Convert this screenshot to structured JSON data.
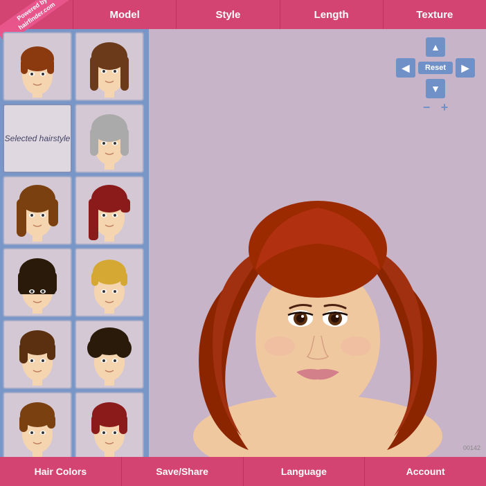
{
  "app": {
    "logo_line1": "Powered by",
    "logo_line2": "hairfinder.com"
  },
  "top_nav": {
    "tabs": [
      {
        "id": "model",
        "label": "Model"
      },
      {
        "id": "style",
        "label": "Style"
      },
      {
        "id": "length",
        "label": "Length"
      },
      {
        "id": "texture",
        "label": "Texture"
      }
    ]
  },
  "sidebar": {
    "selected_label": "Selected hairstyle",
    "thumbnails": [
      {
        "id": 1,
        "alt": "short auburn style"
      },
      {
        "id": 2,
        "alt": "medium layered style"
      },
      {
        "id": 3,
        "alt": "bob style"
      },
      {
        "id": 4,
        "alt": "red asymmetric style"
      },
      {
        "id": 5,
        "alt": "wavy brown style"
      },
      {
        "id": 6,
        "alt": "straight bob style"
      },
      {
        "id": 7,
        "alt": "short blonde style"
      },
      {
        "id": 8,
        "alt": "short wavy style"
      },
      {
        "id": 9,
        "alt": "curly short style"
      },
      {
        "id": 10,
        "alt": "style 10"
      },
      {
        "id": 11,
        "alt": "style 11"
      }
    ]
  },
  "controls": {
    "reset_label": "Reset",
    "up_arrow": "▲",
    "down_arrow": "▼",
    "left_arrow": "◀",
    "right_arrow": "▶",
    "zoom_minus": "−",
    "zoom_plus": "+"
  },
  "version": "00142",
  "bottom_bar": {
    "buttons": [
      {
        "id": "hair-colors",
        "label": "Hair Colors"
      },
      {
        "id": "save-share",
        "label": "Save/Share"
      },
      {
        "id": "language",
        "label": "Language"
      },
      {
        "id": "account",
        "label": "Account"
      }
    ]
  }
}
